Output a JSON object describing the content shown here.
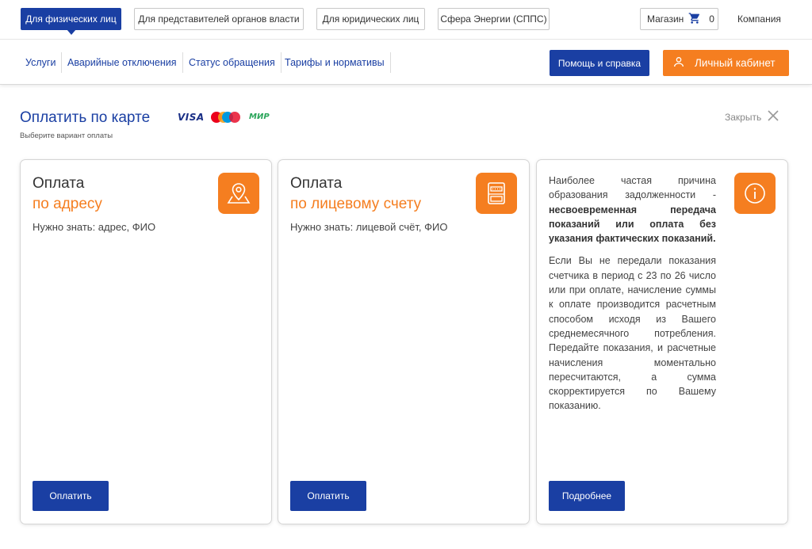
{
  "top_segments": [
    {
      "label": "Для физических лиц"
    },
    {
      "label": "Для представителей органов власти"
    },
    {
      "label": "Для юридических лиц"
    },
    {
      "label": "Сфера Энергии (СППС)"
    }
  ],
  "shop": {
    "label": "Магазин",
    "count": "0",
    "icon": "cart-icon"
  },
  "company": "Компания",
  "nav": [
    "Услуги",
    "Аварийные отключения",
    "Статус обращения",
    "Тарифы и нормативы"
  ],
  "help_button": "Помощь и справка",
  "cabinet_button": "Личный кабинет",
  "page": {
    "title": "Оплатить по карте",
    "subtitle": "Выберите вариант оплаты",
    "card_brands": {
      "visa": "VISA",
      "mir": "МИР"
    },
    "close": "Закрыть"
  },
  "cards": [
    {
      "title": "Оплата",
      "subtitle": "по адресу",
      "need": "Нужно знать: адрес, ФИО",
      "button": "Оплатить",
      "icon": "map-pin-icon"
    },
    {
      "title": "Оплата",
      "subtitle": "по лицевому счету",
      "need": "Нужно знать: лицевой счёт, ФИО",
      "button": "Оплатить",
      "icon": "meter-icon"
    }
  ],
  "info": {
    "p1_a": "Наиболее частая причина образования задолженности - ",
    "p1_b": "несвоевременная передача показаний или оплата без указания фактических показаний.",
    "p2": "Если Вы не передали показания счетчика в период с 23 по 26 число или при оплате, начисление суммы к оплате производится расчетным способом исходя из Вашего среднемесячного потребления. Передайте показания, и расчетные начисления моментально пересчитаются, а сумма скорректируется по Вашему показанию.",
    "button": "Подробнее",
    "icon": "info-icon"
  },
  "colors": {
    "primary": "#1a3fa3",
    "accent": "#f57e20"
  }
}
